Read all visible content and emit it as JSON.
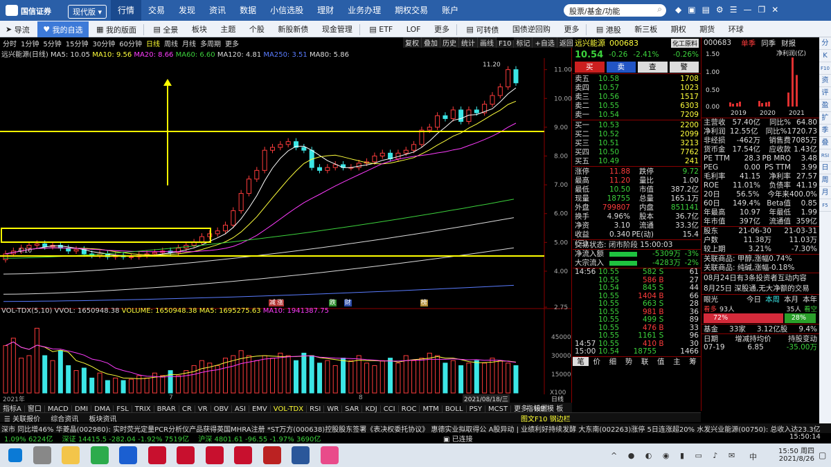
{
  "title_bar": {
    "brand": "国信证券",
    "edition": "现代版",
    "menus": [
      "行情",
      "交易",
      "发现",
      "资讯",
      "数据",
      "小信选股",
      "理财",
      "业务办理",
      "期权交易",
      "账户"
    ],
    "search_placeholder": "股票/基金/功能"
  },
  "nav_bar": {
    "items": [
      "导流",
      "我的自选",
      "我的版面",
      "全景",
      "板块",
      "主题",
      "个股",
      "新股新债",
      "现金管理",
      "ETF",
      "LOF",
      "更多",
      "可转债",
      "国债逆回购",
      "更多",
      "港股",
      "新三板",
      "期权",
      "期货",
      "环球"
    ]
  },
  "period_bar": {
    "items": [
      "分时",
      "1分钟",
      "5分钟",
      "15分钟",
      "30分钟",
      "60分钟",
      "日线",
      "周线",
      "月线",
      "多周期",
      "更多"
    ],
    "active": "日线",
    "tools": [
      "复权",
      "叠加",
      "历史",
      "统计",
      "画线",
      "F10",
      "标记",
      "+自选",
      "返回"
    ]
  },
  "ma_legend": {
    "name": "远兴能源(日线)",
    "ma5": "MA5: 10.05",
    "ma10": "MA10: 9.56",
    "ma20": "MA20: 8.66",
    "ma60": "MA60: 6.60",
    "ma120": "MA120: 4.81",
    "ma250": "MA250: 3.51",
    "ma80": "MA80: 5.86"
  },
  "price_axis": [
    "11.00",
    "10.00",
    "9.00",
    "8.00",
    "7.00",
    "6.00",
    "5.00",
    "4.00",
    "2.75"
  ],
  "high_label": "11.20",
  "low_label": "4.10",
  "vol_legend": {
    "name": "VOL-TDX(5,10)",
    "vvol": "VVOL: 1650948.38",
    "volume": "VOLUME: 1650948.38",
    "ma5": "MA5: 1695275.63",
    "ma10": "MA10: 1941387.75"
  },
  "vol_axis": [
    "45000",
    "30000",
    "15000",
    "X100"
  ],
  "event_marks": [
    "减",
    "涨",
    "跌",
    "财",
    "榜"
  ],
  "x_axis": {
    "start": "2021年",
    "mid1": "7",
    "mid2": "8",
    "date": "2021/08/18/三",
    "right": "日线"
  },
  "indicator_tabs": [
    "指标A",
    "窗口",
    "MACD",
    "DMI",
    "DMA",
    "FSL",
    "TRIX",
    "BRAR",
    "CR",
    "VR",
    "OBV",
    "ASI",
    "EMV",
    "VOL-TDX",
    "RSI",
    "WR",
    "SAR",
    "KDJ",
    "CCI",
    "ROC",
    "MTM",
    "BOLL",
    "PSY",
    "MCST",
    "更多",
    "设置"
  ],
  "indicator_active": "VOL-TDX",
  "indicator_right": "指标B 模 板",
  "bottom_links": [
    "关联报价",
    "综合资讯",
    "板块资讯"
  ],
  "bottom_right": "图文F10 钢边栏",
  "quote": {
    "name": "远兴能源",
    "code": "000683",
    "tag": "化工原料",
    "price": "10.54",
    "change": "-0.26",
    "pct": "-2.41%",
    "pct2": "-0.26%",
    "buttons": [
      "买",
      "卖",
      "查",
      "警"
    ],
    "asks": [
      {
        "label": "卖五",
        "price": "10.58",
        "vol": "1708"
      },
      {
        "label": "卖四",
        "price": "10.57",
        "vol": "1023"
      },
      {
        "label": "卖三",
        "price": "10.56",
        "vol": "1517"
      },
      {
        "label": "卖二",
        "price": "10.55",
        "vol": "6303"
      },
      {
        "label": "卖一",
        "price": "10.54",
        "vol": "7209"
      }
    ],
    "bids": [
      {
        "label": "买一",
        "price": "10.53",
        "vol": "2200"
      },
      {
        "label": "买二",
        "price": "10.52",
        "vol": "2099"
      },
      {
        "label": "买三",
        "price": "10.51",
        "vol": "3213"
      },
      {
        "label": "买四",
        "price": "10.50",
        "vol": "7762"
      },
      {
        "label": "买五",
        "price": "10.49",
        "vol": "241"
      }
    ],
    "stats": [
      [
        "涨停",
        "11.88",
        "跌停",
        "9.72"
      ],
      [
        "最高",
        "11.20",
        "量比",
        "1.00"
      ],
      [
        "最低",
        "10.50",
        "市值",
        "387.2亿"
      ],
      [
        "现量",
        "18755",
        "总量",
        "165.1万"
      ],
      [
        "外盘",
        "799807",
        "内盘",
        "851141"
      ],
      [
        "换手",
        "4.96%",
        "股本",
        "36.7亿"
      ],
      [
        "净资",
        "3.10",
        "流通",
        "33.3亿"
      ],
      [
        "收益(三)",
        "0.340",
        "PE(动)",
        "15.4"
      ]
    ],
    "status": "交易状态: 闭市阶段 15:00:03",
    "flows": [
      {
        "label": "净流入额",
        "value": "-5309万",
        "pct": "-3%"
      },
      {
        "label": "大宗流入",
        "value": "-4283万",
        "pct": "-2%"
      }
    ],
    "ticks": [
      [
        "14:56",
        "10.55",
        "582",
        "S",
        "61"
      ],
      [
        "",
        "10.55",
        "586",
        "B",
        "27"
      ],
      [
        "",
        "10.54",
        "845",
        "S",
        "44"
      ],
      [
        "",
        "10.55",
        "1404",
        "B",
        "66"
      ],
      [
        "",
        "10.55",
        "663",
        "S",
        "28"
      ],
      [
        "",
        "10.55",
        "981",
        "B",
        "36"
      ],
      [
        "",
        "10.55",
        "499",
        "S",
        "89"
      ],
      [
        "",
        "10.55",
        "476",
        "B",
        "33"
      ],
      [
        "",
        "10.55",
        "1161",
        "S",
        "96"
      ],
      [
        "14:57",
        "10.55",
        "410",
        "B",
        "30"
      ],
      [
        "15:00",
        "10.54",
        "18755",
        "",
        "1466"
      ]
    ],
    "tabs": [
      "笔",
      "价",
      "细",
      "势",
      "联",
      "值",
      "主",
      "筹"
    ]
  },
  "info": {
    "code": "000683",
    "tabs": [
      "单季",
      "同季",
      "财报"
    ],
    "chart_title": "净利润(亿)",
    "chart_axis": [
      "1.50",
      "1.00",
      "0.50",
      "0.00"
    ],
    "chart_years": [
      "2019",
      "2020",
      "2021"
    ],
    "fin": [
      [
        "主营收",
        "57.40亿",
        "同比%",
        "64.80"
      ],
      [
        "净利润",
        "12.55亿",
        "同比%",
        "1720.73"
      ],
      [
        "非经损",
        "-462万",
        "销售费",
        "7085万"
      ],
      [
        "货币金",
        "17.54亿",
        "应收款",
        "1.43亿"
      ],
      [
        "PE TTM",
        "28.3",
        "PB MRQ",
        "3.48"
      ],
      [
        "PEG",
        "0.00",
        "PS TTM",
        "3.99"
      ],
      [
        "毛利率",
        "41.15",
        "净利率",
        "27.57"
      ],
      [
        "ROE",
        "11.01%",
        "负债率",
        "41.19"
      ],
      [
        "20日",
        "56.5%",
        "今年来",
        "400.0%"
      ],
      [
        "60日",
        "149.4%",
        "Beta值",
        "0.85"
      ],
      [
        "年最高",
        "10.97",
        "年最低",
        "1.99"
      ],
      [
        "年市值",
        "397亿",
        "流通值",
        "359亿"
      ]
    ],
    "holders": [
      [
        "股东",
        "21-06-30",
        "21-03-31"
      ],
      [
        "户数",
        "11.38万",
        "11.03万"
      ],
      [
        "较上期",
        "3.21%",
        "-7.30%"
      ]
    ],
    "related": [
      "关联商品: 甲醇,涨幅0.74%",
      "关联商品: 纯碱,涨幅-0.18%"
    ],
    "notices": [
      "08月24日有3条投资者互动内容",
      "8月25日 深股通,无大净额的交易"
    ],
    "vote": {
      "title": "眼光",
      "tabs": [
        "今日",
        "本周",
        "本月",
        "本年"
      ],
      "bull_label": "看多",
      "bull_count": "93人",
      "bear_count": "35人",
      "bear_label": "看空",
      "bull_pct": "72%",
      "bear_pct": "28%"
    },
    "fund": [
      "基金",
      "33家",
      "3.12亿股",
      "9.4%"
    ],
    "holdings_hdr": [
      "日期",
      "增减持均价",
      "持股变动"
    ],
    "holdings_row": [
      "07-19",
      "6.85",
      "-35.00万"
    ]
  },
  "side_toolbar": [
    "分",
    "K",
    "F10",
    "资",
    "评",
    "盈",
    "扩",
    "季",
    "叠",
    "RSI",
    "日",
    "周",
    "月",
    "F5"
  ],
  "news": "深市 同比增46%    华菱晶(002980): 实时荧光定量PCR分析仪产品获得英国MHRA注册    *ST万方(000638)控股股东签署《表决权委托协议》  惠德实业拟取得公    A股异动 | 业绩利好持续发酵 大东南(002263)涨停 5日连涨超20%    水发兴业能源(00750): 总收入达23.3亿",
  "index_bar": {
    "sh": "1.09%  6224亿",
    "sz": "深证 14415.5 -282.04 -1.92% 7519亿",
    "hs": "沪深 4801.61 -96.55 -1.97% 3690亿",
    "conn": "已连接",
    "time": "15:50:14"
  },
  "taskbar": {
    "time": "15:50 周四",
    "date": "2021/8/26",
    "lang": "中"
  }
}
